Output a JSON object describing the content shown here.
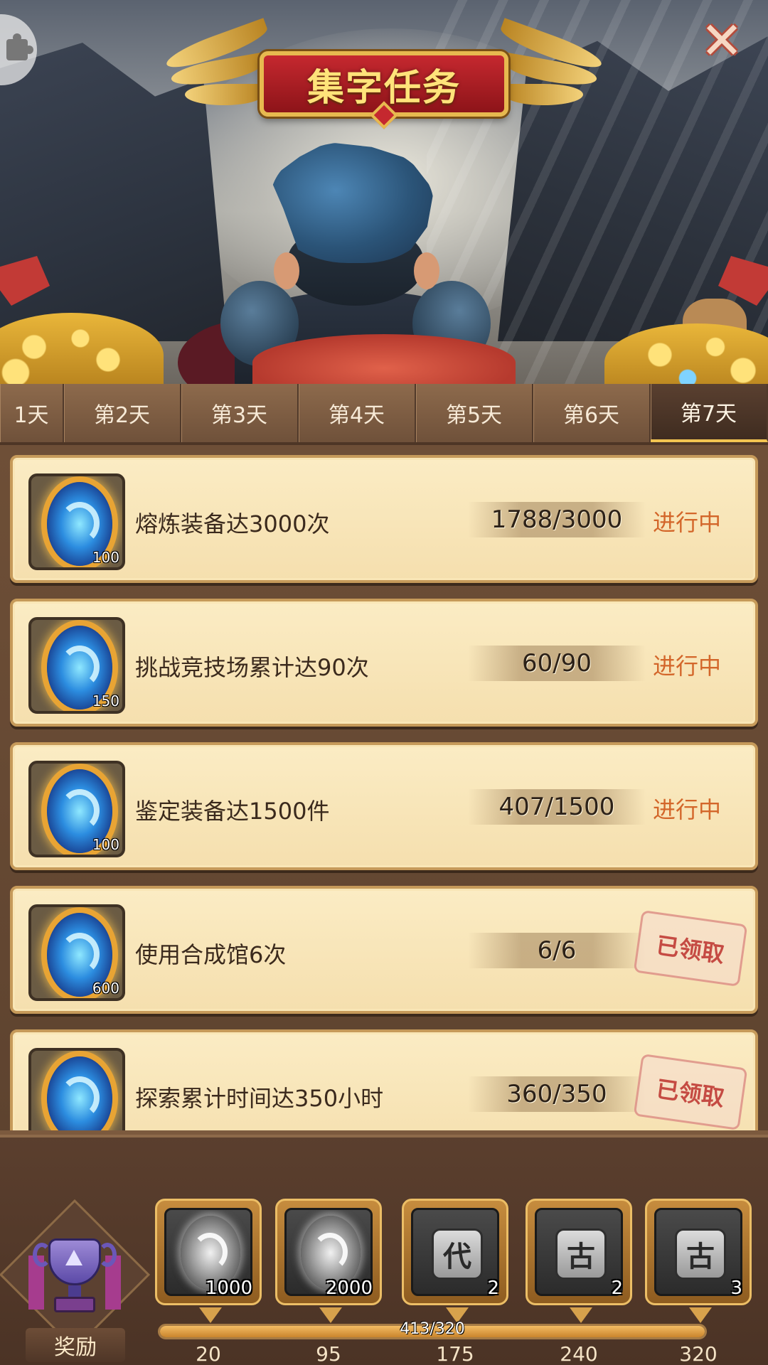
{
  "header": {
    "title": "集字任务"
  },
  "tabs": [
    {
      "label": "1天",
      "active": false
    },
    {
      "label": "第2天",
      "active": false
    },
    {
      "label": "第3天",
      "active": false
    },
    {
      "label": "第4天",
      "active": false
    },
    {
      "label": "第5天",
      "active": false
    },
    {
      "label": "第6天",
      "active": false
    },
    {
      "label": "第7天",
      "active": true
    }
  ],
  "tasks": [
    {
      "reward_count": "100",
      "description": "熔炼装备达3000次",
      "progress": "1788/3000",
      "status": "进行中",
      "claimed": false
    },
    {
      "reward_count": "150",
      "description": "挑战竞技场累计达90次",
      "progress": "60/90",
      "status": "进行中",
      "claimed": false
    },
    {
      "reward_count": "100",
      "description": "鉴定装备达1500件",
      "progress": "407/1500",
      "status": "进行中",
      "claimed": false
    },
    {
      "reward_count": "600",
      "description": "使用合成馆6次",
      "progress": "6/6",
      "status": "已领取",
      "claimed": true
    },
    {
      "reward_count": "",
      "description": "探索累计时间达350小时",
      "progress": "360/350",
      "status": "已领取",
      "claimed": true
    }
  ],
  "rewards": {
    "label": "奖励",
    "items": [
      {
        "icon": "grey-orb-icon",
        "char": "",
        "quantity": "1000",
        "milestone": "20"
      },
      {
        "icon": "grey-orb-icon",
        "char": "",
        "quantity": "2000",
        "milestone": "95"
      },
      {
        "icon": "character-tile-icon",
        "char": "代",
        "quantity": "2",
        "milestone": "175"
      },
      {
        "icon": "character-tile-icon",
        "char": "古",
        "quantity": "2",
        "milestone": "240"
      },
      {
        "icon": "character-tile-icon",
        "char": "古",
        "quantity": "3",
        "milestone": "320"
      }
    ],
    "progress_text": "413/320",
    "progress_fraction": 1.0
  },
  "colors": {
    "status_in_progress": "#d3662a",
    "stamp_claimed": "#c54b43",
    "title_gold": "#ffe37a"
  }
}
